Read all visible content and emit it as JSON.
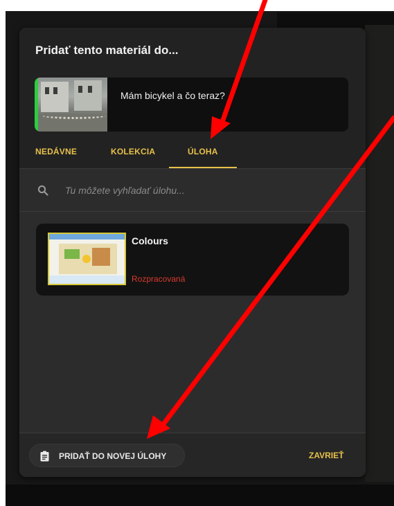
{
  "dialog": {
    "title": "Pridať tento materiál do...",
    "material": {
      "title": "Mám bicykel a čo teraz?"
    },
    "tabs": [
      {
        "label": "NEDÁVNE",
        "active": false
      },
      {
        "label": "KOLEKCIA",
        "active": false
      },
      {
        "label": "ÚLOHA",
        "active": true
      }
    ],
    "search": {
      "placeholder": "Tu môžete vyhľadať úlohu...",
      "icon": "search-icon"
    },
    "tasks": [
      {
        "title": "Colours",
        "status": "Rozpracovaná",
        "status_color": "#d63b2e"
      }
    ],
    "footer": {
      "add_label": "PRIDAŤ DO NOVEJ ÚLOHY",
      "add_icon": "clipboard-icon",
      "close_label": "ZAVRIEŤ"
    }
  },
  "colors": {
    "accent": "#e8c14a",
    "dialog_bg": "#2c2c2c",
    "header_bg": "#222222",
    "card_bg": "#121212",
    "annotation_arrow": "#ff0000"
  }
}
